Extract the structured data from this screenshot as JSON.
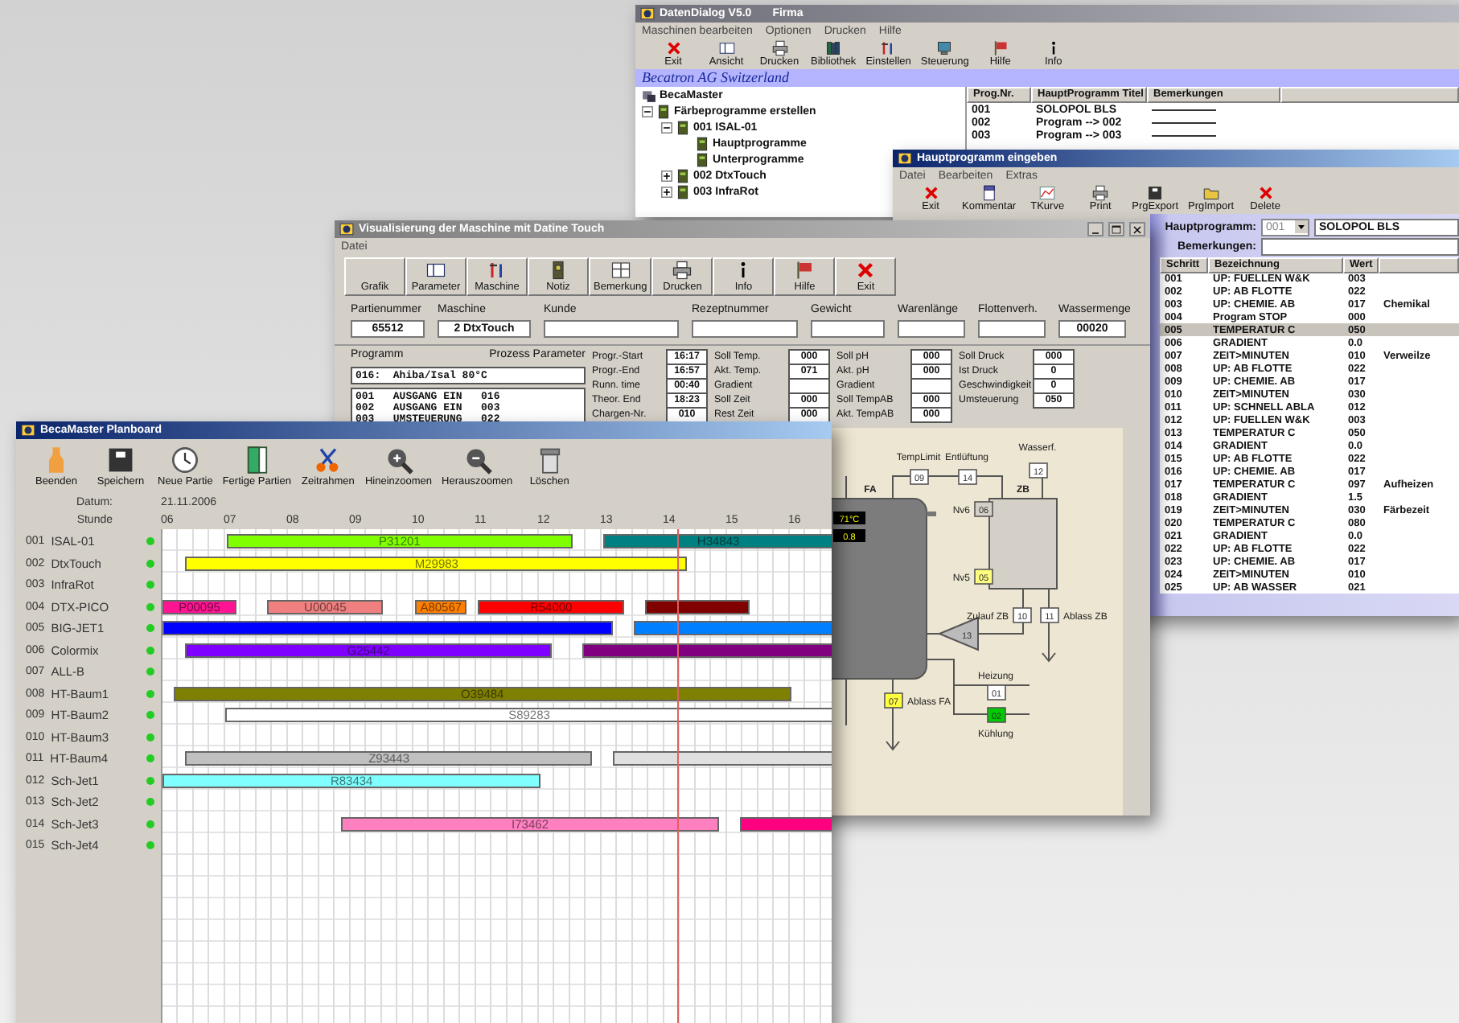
{
  "data_dialog": {
    "title": "DatenDialog V5.0",
    "subtitle": "Firma",
    "menu": [
      "Maschinen bearbeiten",
      "Optionen",
      "Drucken",
      "Hilfe"
    ],
    "toolbar": [
      "Exit",
      "Ansicht",
      "Drucken",
      "Bibliothek",
      "Einstellen",
      "Steuerung",
      "Hilfe",
      "Info"
    ],
    "banner": "Becatron AG Switzerland",
    "tree": {
      "root": "BecaMaster",
      "items": [
        {
          "label": "Färbeprogramme erstellen",
          "expanded": true,
          "children": [
            {
              "label": "001 ISAL-01",
              "expanded": true,
              "children": [
                {
                  "label": "Hauptprogramme"
                },
                {
                  "label": "Unterprogramme"
                }
              ]
            },
            {
              "label": "002 DtxTouch",
              "expanded": false
            },
            {
              "label": "003 InfraRot",
              "expanded": false
            }
          ]
        }
      ]
    },
    "table": {
      "columns": [
        "Prog.Nr.",
        "HauptProgramm Titel",
        "Bemerkungen"
      ],
      "rows": [
        {
          "nr": "001",
          "title": "SOLOPOL BLS"
        },
        {
          "nr": "002",
          "title": "Program --> 002"
        },
        {
          "nr": "003",
          "title": "Program --> 003"
        }
      ]
    }
  },
  "program_editor": {
    "title": "Hauptprogramm eingeben",
    "menu": [
      "Datei",
      "Bearbeiten",
      "Extras"
    ],
    "toolbar": [
      "Exit",
      "Kommentar",
      "TKurve",
      "Print",
      "PrgExport",
      "PrgImport",
      "Delete"
    ],
    "program_label": "Hauptprogramm:",
    "program_number": "001",
    "program_title": "SOLOPOL BLS",
    "remarks_label": "Bemerkungen:",
    "columns": [
      "Schritt",
      "Bezeichnung",
      "Wert"
    ],
    "steps": [
      {
        "step": "001",
        "name": "UP: FUELLEN W&K",
        "value": "003",
        "selected": false
      },
      {
        "step": "002",
        "name": "UP: AB FLOTTE",
        "value": "022",
        "selected": false
      },
      {
        "step": "003",
        "name": "UP: CHEMIE. AB",
        "value": "017",
        "note": "Chemikal",
        "selected": false
      },
      {
        "step": "004",
        "name": "Program STOP",
        "value": "000",
        "selected": false
      },
      {
        "step": "005",
        "name": "TEMPERATUR C",
        "value": "050",
        "selected": true
      },
      {
        "step": "006",
        "name": "GRADIENT",
        "value": "0.0",
        "selected": false
      },
      {
        "step": "007",
        "name": "ZEIT>MINUTEN",
        "value": "010",
        "note": "Verweilze",
        "selected": false
      },
      {
        "step": "008",
        "name": "UP: AB FLOTTE",
        "value": "022",
        "selected": false
      },
      {
        "step": "009",
        "name": "UP: CHEMIE. AB",
        "value": "017",
        "selected": false
      },
      {
        "step": "010",
        "name": "ZEIT>MINUTEN",
        "value": "030",
        "selected": false
      },
      {
        "step": "011",
        "name": "UP: SCHNELL ABLA",
        "value": "012",
        "selected": false
      },
      {
        "step": "012",
        "name": "UP: FUELLEN W&K",
        "value": "003",
        "selected": false
      },
      {
        "step": "013",
        "name": "TEMPERATUR C",
        "value": "050",
        "selected": false
      },
      {
        "step": "014",
        "name": "GRADIENT",
        "value": "0.0",
        "selected": false
      },
      {
        "step": "015",
        "name": "UP: AB FLOTTE",
        "value": "022",
        "selected": false
      },
      {
        "step": "016",
        "name": "UP: CHEMIE. AB",
        "value": "017",
        "selected": false
      },
      {
        "step": "017",
        "name": "TEMPERATUR C",
        "value": "097",
        "note": "Aufheizen",
        "selected": false
      },
      {
        "step": "018",
        "name": "GRADIENT",
        "value": "1.5",
        "selected": false
      },
      {
        "step": "019",
        "name": "ZEIT>MINUTEN",
        "value": "030",
        "note": "Färbezeit",
        "selected": false
      },
      {
        "step": "020",
        "name": "TEMPERATUR C",
        "value": "080",
        "selected": false
      },
      {
        "step": "021",
        "name": "GRADIENT",
        "value": "0.0",
        "selected": false
      },
      {
        "step": "022",
        "name": "UP: AB FLOTTE",
        "value": "022",
        "selected": false
      },
      {
        "step": "023",
        "name": "UP: CHEMIE. AB",
        "value": "017",
        "selected": false
      },
      {
        "step": "024",
        "name": "ZEIT>MINUTEN",
        "value": "010",
        "selected": false
      },
      {
        "step": "025",
        "name": "UP: AB WASSER",
        "value": "021",
        "selected": false
      }
    ]
  },
  "visualization": {
    "title": "Visualisierung der Maschine mit Datine Touch",
    "menu": [
      "Datei"
    ],
    "toolbar": [
      "Grafik",
      "Parameter",
      "Maschine",
      "Notiz",
      "Bemerkung",
      "Drucken",
      "Info",
      "Hilfe",
      "Exit"
    ],
    "fields": [
      {
        "label": "Partienummer",
        "value": "65512"
      },
      {
        "label": "Maschine",
        "value": "2 DtxTouch"
      },
      {
        "label": "Kunde"
      },
      {
        "label": "Rezeptnummer"
      },
      {
        "label": "Gewicht"
      },
      {
        "label": "Warenlänge"
      },
      {
        "label": "Flottenverh."
      },
      {
        "label": "Wassermenge",
        "value": "00020"
      }
    ],
    "program_label": "Programm",
    "process_label": "Prozess Parameter",
    "program_name": "016:  Ahiba/Isal 80°C",
    "program_steps": [
      "001   AUSGANG EIN   016",
      "002   AUSGANG EIN   003",
      "003   UMSTEUERUNG   022"
    ],
    "params": [
      [
        {
          "label": "Progr.-Start",
          "value": "16:17"
        },
        {
          "label": "Progr.-End",
          "value": "16:57"
        },
        {
          "label": "Runn. time",
          "value": "00:40"
        },
        {
          "label": "Theor. End",
          "value": "18:23"
        },
        {
          "label": "Chargen-Nr.",
          "value": "010"
        }
      ],
      [
        {
          "label": "Soll Temp.",
          "value": "000"
        },
        {
          "label": "Akt. Temp.",
          "value": "071"
        },
        {
          "label": "Gradient"
        },
        {
          "label": "Soll Zeit",
          "value": "000"
        },
        {
          "label": "Rest Zeit",
          "value": "000"
        }
      ],
      [
        {
          "label": "Soll pH",
          "value": "000"
        },
        {
          "label": "Akt. pH",
          "value": "000"
        },
        {
          "label": "Gradient"
        },
        {
          "label": "Soll TempAB",
          "value": "000"
        },
        {
          "label": "Akt. TempAB",
          "value": "000"
        }
      ],
      [
        {
          "label": "Soll Druck",
          "value": "000"
        },
        {
          "label": "Ist Druck",
          "value": "0"
        },
        {
          "label": "Geschwindigkeit",
          "value": "0"
        },
        {
          "label": "Umsteuerung",
          "value": "050"
        }
      ]
    ],
    "diagram": {
      "vessel_label": "FA",
      "tank_label": "ZB",
      "readings": [
        "71°C",
        "0.8"
      ],
      "pump_number": "13",
      "valves": [
        {
          "number": "09",
          "caption": "TempLimit",
          "color": "#ffffff"
        },
        {
          "number": "14",
          "caption": "Entlüftung",
          "color": "#ffffff"
        },
        {
          "number": "12",
          "caption": "Wasserf.",
          "color": "#ffffff"
        },
        {
          "number": "06",
          "caption": "Nv6",
          "color": "#d4d0c8"
        },
        {
          "number": "05",
          "caption": "Nv5",
          "color": "#ffff80"
        },
        {
          "number": "10",
          "caption": "Zulauf ZB",
          "color": "#ffffff"
        },
        {
          "number": "11",
          "caption": "Ablass ZB",
          "color": "#ffffff"
        },
        {
          "number": "01",
          "caption": "Heizung",
          "color": "#ffffff"
        },
        {
          "number": "07",
          "caption": "Ablass FA",
          "color": "#ffff40"
        },
        {
          "number": "02",
          "caption": "Kühlung",
          "color": "#00cc00"
        }
      ]
    }
  },
  "planboard": {
    "title": "BecaMaster Planboard",
    "toolbar": [
      "Beenden",
      "Speichern",
      "Neue Partie",
      "Fertige Partien",
      "Zeitrahmen",
      "Hineinzoomen",
      "Herauszoomen",
      "Löschen"
    ],
    "date_label": "Datum:",
    "date": "21.11.2006",
    "hour_label": "Stunde",
    "hours": [
      "06",
      "07",
      "08",
      "09",
      "10",
      "11",
      "12",
      "13",
      "14",
      "15",
      "16"
    ],
    "machines": [
      {
        "nr": "001",
        "name": "ISAL-01",
        "online": true,
        "bars": [
          {
            "label": "P31201",
            "color": "#80ff00"
          },
          {
            "label": "H34843",
            "color": "#008080"
          }
        ]
      },
      {
        "nr": "002",
        "name": "DtxTouch",
        "online": true,
        "bars": [
          {
            "label": "M29983",
            "color": "#ffff00"
          }
        ]
      },
      {
        "nr": "003",
        "name": "InfraRot",
        "online": true
      },
      {
        "nr": "004",
        "name": "DTX-PICO",
        "online": true,
        "bars": [
          {
            "label": "P00095",
            "color": "#ff1493"
          },
          {
            "label": "U00045",
            "color": "#f08080"
          },
          {
            "label": "A80567",
            "color": "#ff8000"
          },
          {
            "label": "R54000",
            "color": "#ff0000"
          },
          {
            "color": "#800000"
          }
        ]
      },
      {
        "nr": "005",
        "name": "BIG-JET1",
        "online": true,
        "bars": [
          {
            "color": "#0000ff"
          },
          {
            "color": "#0080ff"
          }
        ]
      },
      {
        "nr": "006",
        "name": "Colormix",
        "online": true,
        "bars": [
          {
            "label": "G25442",
            "color": "#8000ff"
          },
          {
            "color": "#800080"
          }
        ]
      },
      {
        "nr": "007",
        "name": "ALL-B",
        "online": true
      },
      {
        "nr": "008",
        "name": "HT-Baum1",
        "online": true,
        "bars": [
          {
            "label": "O39484",
            "color": "#808000"
          }
        ]
      },
      {
        "nr": "009",
        "name": "HT-Baum2",
        "online": true,
        "bars": [
          {
            "label": "S89283",
            "color": "#ffffff"
          }
        ]
      },
      {
        "nr": "010",
        "name": "HT-Baum3",
        "online": true
      },
      {
        "nr": "011",
        "name": "HT-Baum4",
        "online": true,
        "bars": [
          {
            "label": "Z93443",
            "color": "#c0c0c0"
          },
          {
            "color": "#e0e0e0"
          }
        ]
      },
      {
        "nr": "012",
        "name": "Sch-Jet1",
        "online": true,
        "bars": [
          {
            "label": "R83434",
            "color": "#80ffff"
          }
        ]
      },
      {
        "nr": "013",
        "name": "Sch-Jet2",
        "online": true
      },
      {
        "nr": "014",
        "name": "Sch-Jet3",
        "online": true,
        "bars": [
          {
            "label": "I73462",
            "color": "#ff80c0"
          },
          {
            "color": "#ff0080"
          }
        ]
      },
      {
        "nr": "015",
        "name": "Sch-Jet4",
        "online": true
      }
    ]
  }
}
